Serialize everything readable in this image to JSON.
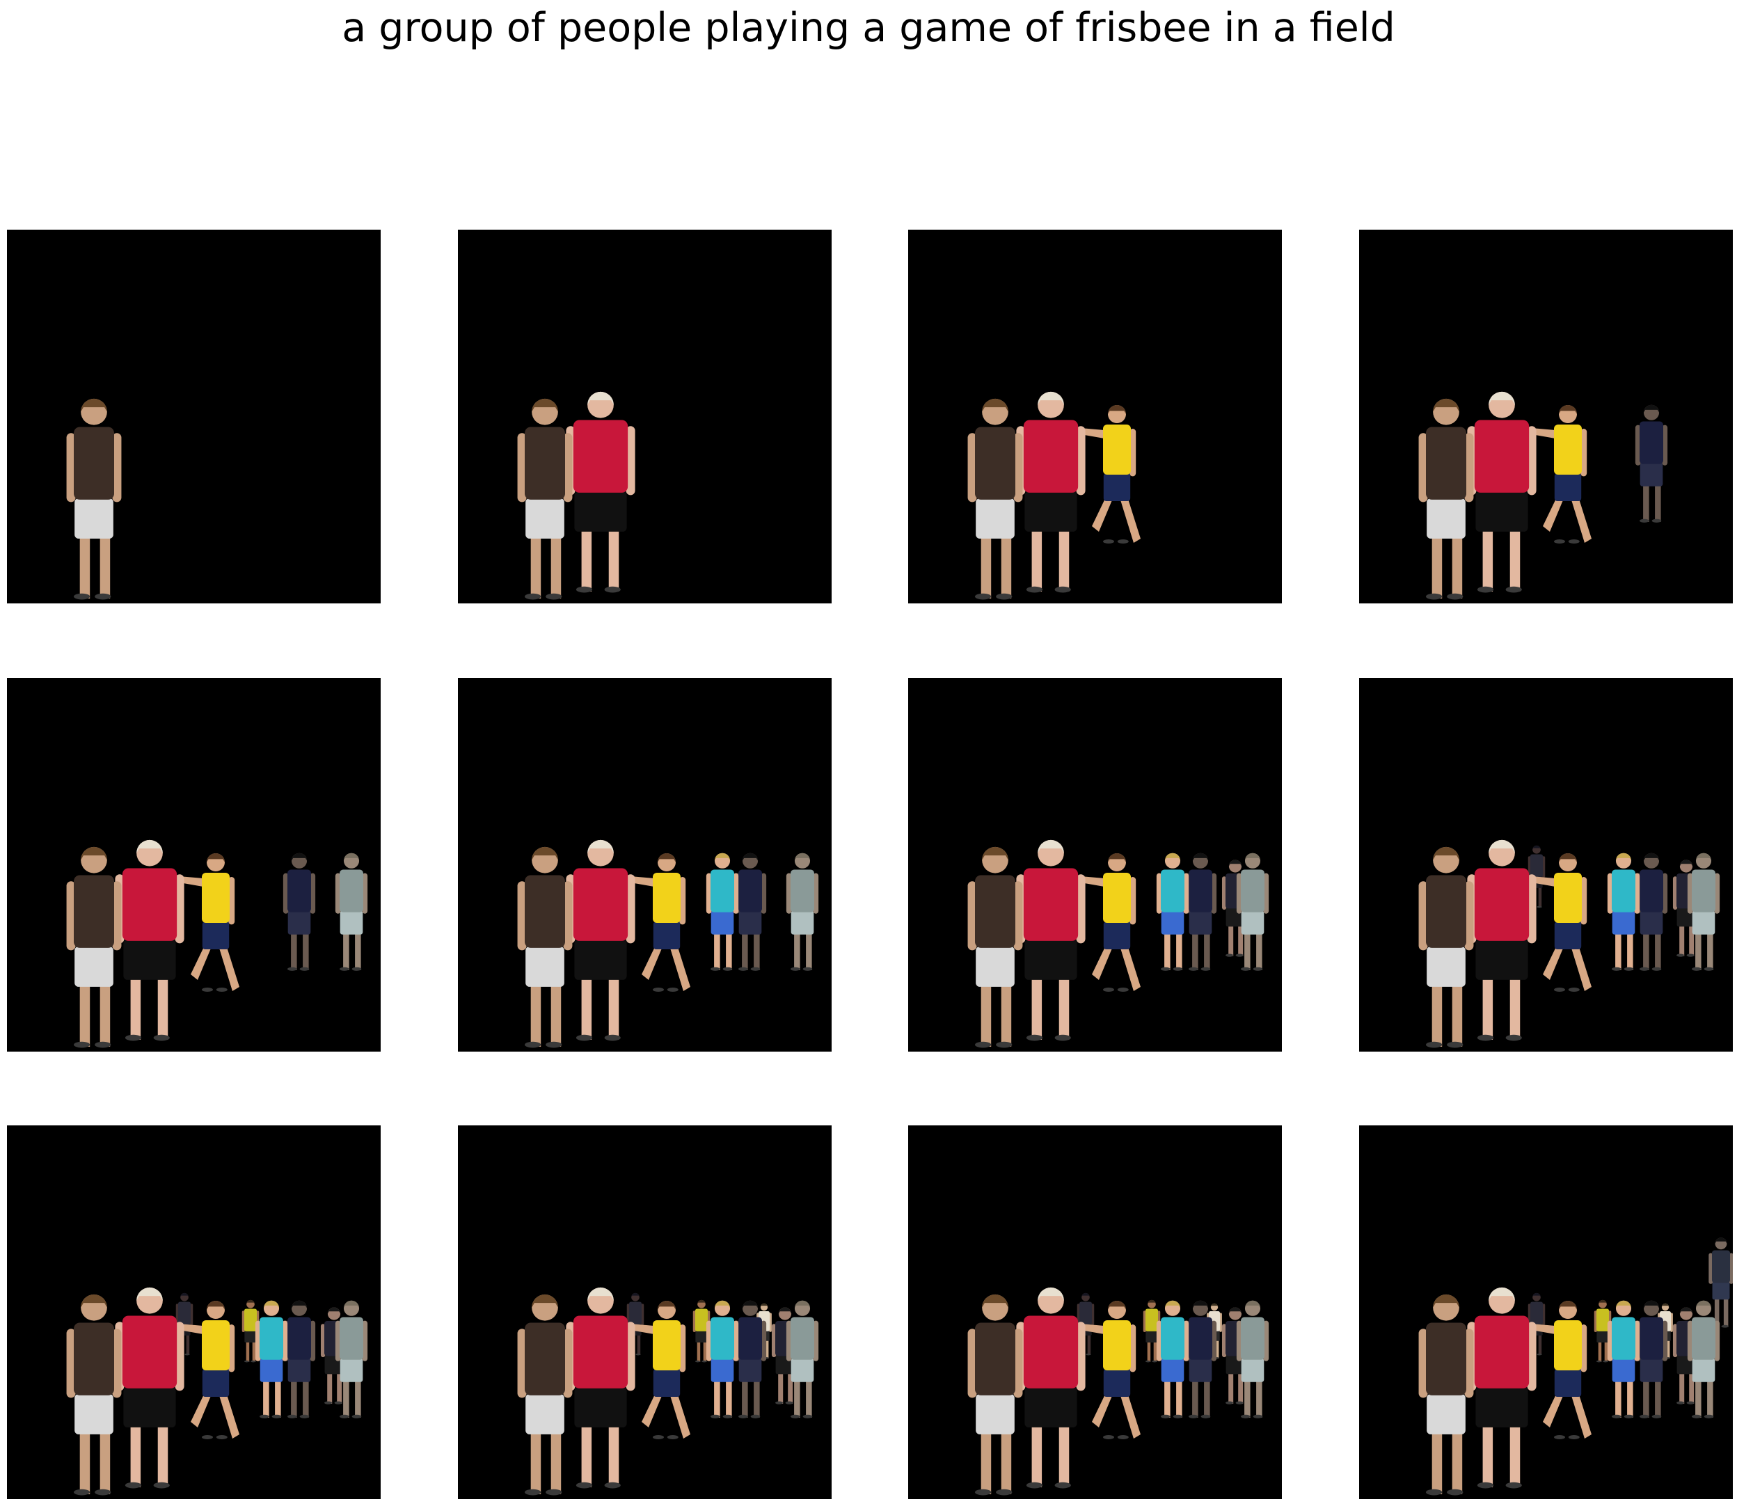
{
  "title": "a group of people playing a game of frisbee in a field",
  "background_color": "#ffffff",
  "panel_background": "#000000",
  "panel_count": 12,
  "grid_columns": 4,
  "grid_rows": 3,
  "people": [
    {
      "id": "man-brown-shirt",
      "shirt": "#3d2e26",
      "pants": "#d9d9d9",
      "skin": "#c9a080",
      "hair": "#6b4a2a"
    },
    {
      "id": "man-red-shirt",
      "shirt": "#c8173a",
      "pants": "#111111",
      "skin": "#e3b8a0",
      "hair": "#e8e0d0"
    },
    {
      "id": "boy-yellow-jersey",
      "shirt": "#f2d21a",
      "pants": "#1c2a5a",
      "skin": "#d8a884",
      "hair": "#5a3a22"
    },
    {
      "id": "player-striped",
      "shirt": "#1c2040",
      "pants": "#2a2e4a",
      "skin": "#6a5a50",
      "hair": "#111111"
    },
    {
      "id": "player-gray-faded",
      "shirt": "#8a9a98",
      "pants": "#b0c0c0",
      "skin": "#9a8878",
      "hair": "#7a7060"
    },
    {
      "id": "girl-cyan-jersey",
      "shirt": "#2fb8c8",
      "pants": "#3a6ad0",
      "skin": "#e0b090",
      "hair": "#c8a850"
    },
    {
      "id": "child-background",
      "shirt": "#222233",
      "pants": "#1a1a1a",
      "skin": "#a08070",
      "hair": "#1a1a1a"
    },
    {
      "id": "player-dark-back",
      "shirt": "#2a2a38",
      "pants": "#1a1a20",
      "skin": "#403030",
      "hair": "#151520"
    },
    {
      "id": "player-yellow-back",
      "shirt": "#c8c020",
      "pants": "#202020",
      "skin": "#a07050",
      "hair": "#3a2a1a"
    },
    {
      "id": "hands-blurry",
      "shirt": "#e8e0d0",
      "pants": "#2a2a2a",
      "skin": "#d0b090",
      "hair": "#3a3020"
    },
    {
      "id": "person-far-right",
      "shirt": "#2a3040",
      "pants": "#303850",
      "skin": "#7a6a60",
      "hair": "#101010"
    }
  ],
  "panels": [
    {
      "people": [
        "man-brown-shirt"
      ]
    },
    {
      "people": [
        "man-brown-shirt",
        "man-red-shirt"
      ]
    },
    {
      "people": [
        "man-brown-shirt",
        "man-red-shirt",
        "boy-yellow-jersey"
      ]
    },
    {
      "people": [
        "man-brown-shirt",
        "man-red-shirt",
        "boy-yellow-jersey",
        "player-striped"
      ]
    },
    {
      "people": [
        "man-brown-shirt",
        "man-red-shirt",
        "boy-yellow-jersey",
        "player-striped",
        "player-gray-faded"
      ]
    },
    {
      "people": [
        "man-brown-shirt",
        "man-red-shirt",
        "boy-yellow-jersey",
        "player-striped",
        "player-gray-faded",
        "girl-cyan-jersey"
      ]
    },
    {
      "people": [
        "man-brown-shirt",
        "man-red-shirt",
        "boy-yellow-jersey",
        "player-striped",
        "player-gray-faded",
        "girl-cyan-jersey",
        "child-background"
      ]
    },
    {
      "people": [
        "man-brown-shirt",
        "man-red-shirt",
        "boy-yellow-jersey",
        "player-striped",
        "player-gray-faded",
        "girl-cyan-jersey",
        "child-background",
        "player-dark-back"
      ]
    },
    {
      "people": [
        "man-brown-shirt",
        "man-red-shirt",
        "boy-yellow-jersey",
        "player-striped",
        "player-gray-faded",
        "girl-cyan-jersey",
        "child-background",
        "player-dark-back",
        "player-yellow-back"
      ]
    },
    {
      "people": [
        "man-brown-shirt",
        "man-red-shirt",
        "boy-yellow-jersey",
        "player-striped",
        "player-gray-faded",
        "girl-cyan-jersey",
        "child-background",
        "player-dark-back",
        "player-yellow-back",
        "hands-blurry"
      ]
    },
    {
      "people": [
        "man-brown-shirt",
        "man-red-shirt",
        "boy-yellow-jersey",
        "player-striped",
        "player-gray-faded",
        "girl-cyan-jersey",
        "child-background",
        "player-dark-back",
        "player-yellow-back",
        "hands-blurry"
      ]
    },
    {
      "people": [
        "man-brown-shirt",
        "man-red-shirt",
        "boy-yellow-jersey",
        "player-striped",
        "player-gray-faded",
        "girl-cyan-jersey",
        "child-background",
        "player-dark-back",
        "player-yellow-back",
        "hands-blurry",
        "person-far-right"
      ]
    }
  ]
}
